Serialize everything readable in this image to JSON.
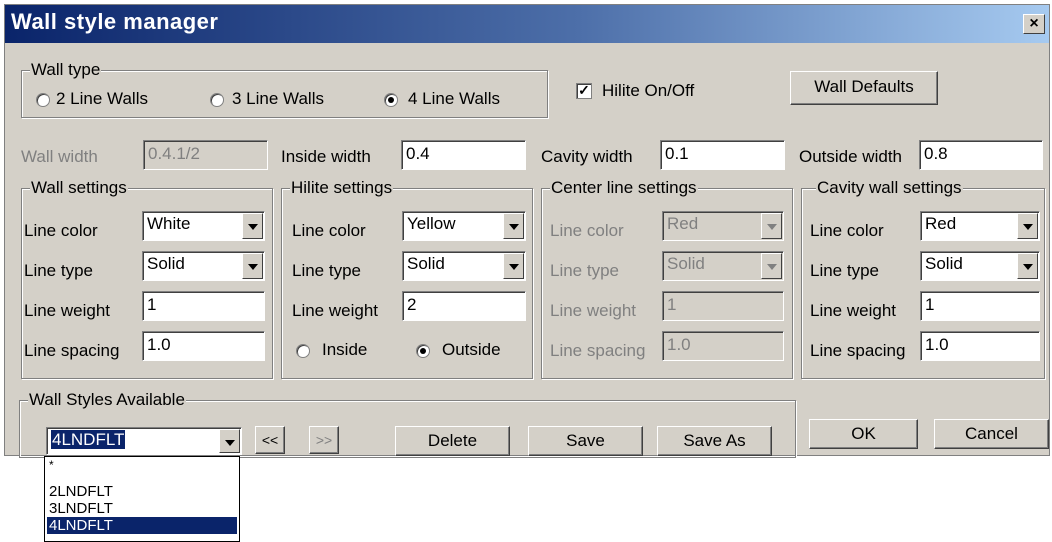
{
  "window": {
    "title": "Wall style manager",
    "close_glyph": "×"
  },
  "wall_type": {
    "legend": "Wall type",
    "options": [
      "2 Line Walls",
      "3 Line Walls",
      "4 Line Walls"
    ],
    "selected": "4 Line Walls"
  },
  "hilite_toggle": {
    "label": "Hilite On/Off",
    "checked": true,
    "check_glyph": "✓"
  },
  "wall_defaults_button": "Wall Defaults",
  "widths": {
    "wall_width_label": "Wall width",
    "wall_width_value": "0.4.1/2",
    "inside_width_label": "Inside width",
    "inside_width_value": "0.4",
    "cavity_width_label": "Cavity width",
    "cavity_width_value": "0.1",
    "outside_width_label": "Outside width",
    "outside_width_value": "0.8"
  },
  "labels": {
    "line_color": "Line color",
    "line_type": "Line type",
    "line_weight": "Line weight",
    "line_spacing": "Line spacing"
  },
  "wall_settings": {
    "legend": "Wall settings",
    "line_color": "White",
    "line_type": "Solid",
    "line_weight": "1",
    "line_spacing": "1.0"
  },
  "hilite_settings": {
    "legend": "Hilite settings",
    "line_color": "Yellow",
    "line_type": "Solid",
    "line_weight": "2",
    "inside_label": "Inside",
    "outside_label": "Outside",
    "selected": "Outside"
  },
  "center_line_settings": {
    "legend": "Center line settings",
    "line_color": "Red",
    "line_type": "Solid",
    "line_weight": "1",
    "line_spacing": "1.0",
    "disabled": true
  },
  "cavity_wall_settings": {
    "legend": "Cavity wall settings",
    "line_color": "Red",
    "line_type": "Solid",
    "line_weight": "1",
    "line_spacing": "1.0"
  },
  "wall_styles": {
    "legend": "Wall Styles Available",
    "selected": "4LNDFLT",
    "prev_label": "<<",
    "next_label": ">>",
    "delete_label": "Delete",
    "save_label": "Save",
    "save_as_label": "Save As",
    "dropdown_items": [
      "*",
      "2LNDFLT",
      "3LNDFLT",
      "4LNDFLT"
    ]
  },
  "ok_label": "OK",
  "cancel_label": "Cancel",
  "colors": {
    "title_start": "#0a246a",
    "title_end": "#a6caf0",
    "dialog_bg": "#d4d0c8",
    "selection": "#0a246a"
  }
}
